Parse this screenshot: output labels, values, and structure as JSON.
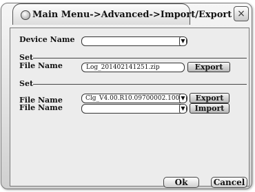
{
  "window": {
    "title": "Main Menu->Advanced->Import/Export",
    "close_glyph": "×"
  },
  "device": {
    "label": "Device Name",
    "value": ""
  },
  "section1": {
    "set_label": "Set",
    "file_label": "File Name",
    "file_value": "Log_201402141251.zip",
    "export_label": "Export"
  },
  "section2": {
    "set_label": "Set",
    "file1_label": "File Name",
    "file1_value": "Clg_V4.00.R10.09700002.100",
    "export_label": "Export",
    "file2_label": "File Name",
    "file2_value": "",
    "import_label": "Import"
  },
  "footer": {
    "ok_label": "Ok",
    "cancel_label": "Cancel"
  },
  "icons": {
    "dropdown": "dropdown-arrow-icon",
    "close": "close-icon",
    "title": "title-circle-icon"
  }
}
